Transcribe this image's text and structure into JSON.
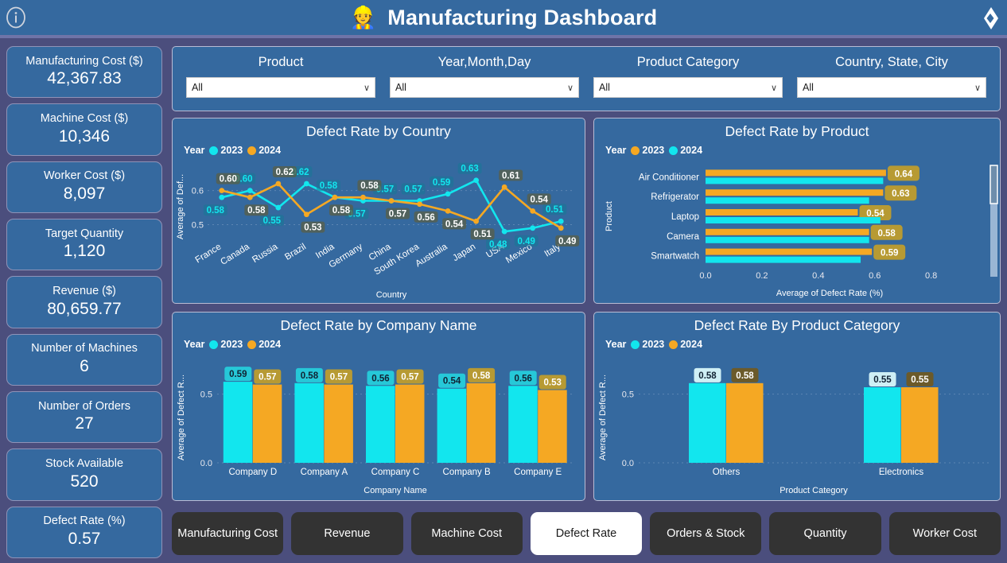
{
  "header": {
    "title": "Manufacturing Dashboard",
    "left_icon": "info-circle-icon",
    "right_icon": "tag-diamond-icon",
    "logo_icon": "factory-worker-icon",
    "bg_color": "#35699f"
  },
  "theme": {
    "page_bg": "#4b4e7d",
    "panel_bg": "#35699f",
    "panel_border": "#b9bcd4",
    "cyan": "#12e6ee",
    "orange": "#f5a823",
    "tab_bg": "#333333",
    "tab_active_bg": "#ffffff"
  },
  "kpis": [
    {
      "label": "Manufacturing Cost ($)",
      "value": "42,367.83"
    },
    {
      "label": "Machine Cost ($)",
      "value": "10,346"
    },
    {
      "label": "Worker Cost ($)",
      "value": "8,097"
    },
    {
      "label": "Target Quantity",
      "value": "1,120"
    },
    {
      "label": "Revenue ($)",
      "value": "80,659.77"
    },
    {
      "label": "Number of Machines",
      "value": "6"
    },
    {
      "label": "Number of Orders",
      "value": "27"
    },
    {
      "label": "Stock Available",
      "value": "520"
    },
    {
      "label": "Defect Rate (%)",
      "value": "0.57"
    }
  ],
  "filters": [
    {
      "label": "Product",
      "value": "All"
    },
    {
      "label": "Year,Month,Day",
      "value": "All"
    },
    {
      "label": "Product Category",
      "value": "All"
    },
    {
      "label": "Country, State, City",
      "value": "All"
    }
  ],
  "tabs": [
    {
      "label": "Manufacturing Cost",
      "active": false
    },
    {
      "label": "Revenue",
      "active": false
    },
    {
      "label": "Machine Cost",
      "active": false
    },
    {
      "label": "Defect Rate",
      "active": true
    },
    {
      "label": "Orders & Stock",
      "active": false
    },
    {
      "label": "Quantity",
      "active": false
    },
    {
      "label": "Worker Cost",
      "active": false
    }
  ],
  "chart_data": [
    {
      "id": "country",
      "type": "line",
      "title": "Defect Rate by Country",
      "xlabel": "Country",
      "ylabel": "Average of Def...",
      "ylim": [
        0.45,
        0.655
      ],
      "yticks": [
        0.5,
        0.6
      ],
      "ytick_labels": [
        "0.5",
        "0.6"
      ],
      "legend_title": "Year",
      "legend_position": "top-left",
      "grid": true,
      "categories": [
        "France",
        "Canada",
        "Russia",
        "Brazil",
        "India",
        "Germany",
        "China",
        "South Korea",
        "Australia",
        "Japan",
        "USA",
        "Mexico",
        "Italy"
      ],
      "series": [
        {
          "name": "2023",
          "color": "#12e6ee",
          "values": [
            0.58,
            0.6,
            0.55,
            0.62,
            0.58,
            0.57,
            0.57,
            0.57,
            0.59,
            0.63,
            0.48,
            0.49,
            0.51
          ]
        },
        {
          "name": "2024",
          "color": "#f5a823",
          "values": [
            0.6,
            0.58,
            0.62,
            0.53,
            0.58,
            0.58,
            0.57,
            0.56,
            0.54,
            0.51,
            0.61,
            0.54,
            0.49
          ]
        }
      ]
    },
    {
      "id": "product",
      "type": "bar",
      "orientation": "horizontal",
      "title": "Defect Rate by Product",
      "xlabel": "Average of Defect Rate (%)",
      "ylabel": "Product",
      "xlim": [
        0,
        0.88
      ],
      "xticks": [
        0.0,
        0.2,
        0.4,
        0.6,
        0.8
      ],
      "xtick_labels": [
        "0.0",
        "0.2",
        "0.4",
        "0.6",
        "0.8"
      ],
      "legend_title": "Year",
      "legend_position": "top-left",
      "scrollbar": true,
      "categories": [
        "Air Conditioner",
        "Refrigerator",
        "Laptop",
        "Camera",
        "Smartwatch"
      ],
      "series": [
        {
          "name": "2023",
          "color": "#f5a823",
          "values": [
            0.64,
            0.63,
            0.54,
            0.58,
            0.59
          ],
          "labeled": true
        },
        {
          "name": "2024",
          "color": "#12e6ee",
          "values": [
            0.63,
            0.58,
            0.62,
            0.58,
            0.55
          ],
          "labeled": false
        }
      ]
    },
    {
      "id": "company",
      "type": "bar",
      "orientation": "vertical",
      "title": "Defect Rate by Company Name",
      "xlabel": "Company Name",
      "ylabel": "Average of Defect R...",
      "ylim": [
        0,
        0.66
      ],
      "yticks": [
        0.0,
        0.5
      ],
      "ytick_labels": [
        "0.0",
        "0.5"
      ],
      "legend_title": "Year",
      "legend_position": "top-left",
      "categories": [
        "Company D",
        "Company A",
        "Company C",
        "Company B",
        "Company E"
      ],
      "series": [
        {
          "name": "2023",
          "color": "#12e6ee",
          "values": [
            0.59,
            0.58,
            0.56,
            0.54,
            0.56
          ]
        },
        {
          "name": "2024",
          "color": "#f5a823",
          "values": [
            0.57,
            0.57,
            0.57,
            0.58,
            0.53
          ]
        }
      ]
    },
    {
      "id": "category",
      "type": "bar",
      "orientation": "vertical",
      "title": "Defect Rate By Product Category",
      "xlabel": "Product Category",
      "ylabel": "Average of Defect R...",
      "ylim": [
        0,
        0.66
      ],
      "yticks": [
        0.0,
        0.5
      ],
      "ytick_labels": [
        "0.0",
        "0.5"
      ],
      "legend_title": "Year",
      "legend_position": "top-left",
      "categories": [
        "Others",
        "Electronics"
      ],
      "series": [
        {
          "name": "2023",
          "color": "#12e6ee",
          "values": [
            0.58,
            0.55
          ]
        },
        {
          "name": "2024",
          "color": "#f5a823",
          "values": [
            0.58,
            0.55
          ]
        }
      ]
    }
  ]
}
